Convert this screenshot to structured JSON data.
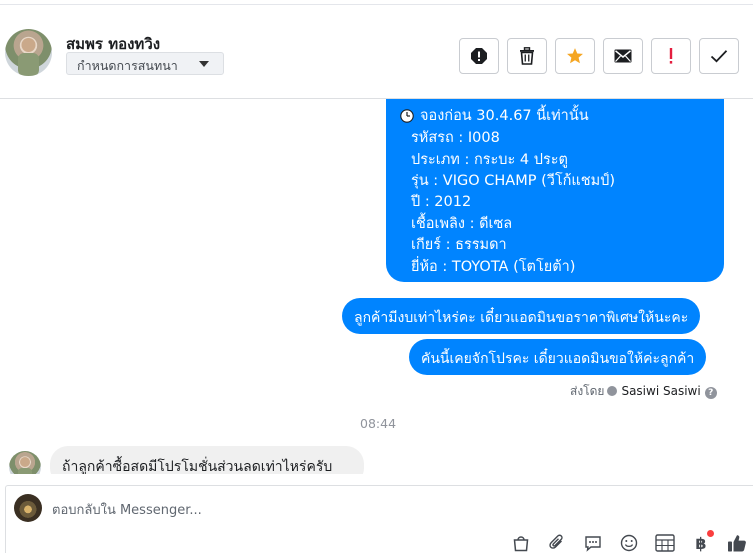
{
  "header": {
    "contact_name": "สมพร ทองทวิง",
    "assign_label": "กำหนดการสนทนา",
    "tools": [
      {
        "name": "spam-icon",
        "color": "#1c1e21"
      },
      {
        "name": "trash-icon",
        "color": "#1c1e21"
      },
      {
        "name": "star-icon",
        "color": "#f5a623"
      },
      {
        "name": "envelope-icon",
        "color": "#1c1e21"
      },
      {
        "name": "exclamation-icon",
        "color": "#e41e3f"
      },
      {
        "name": "checkmark-icon",
        "color": "#1c1e21"
      }
    ]
  },
  "messages": {
    "listing": {
      "deadline": "จองก่อน 30.4.67 นี้เท่านั้น",
      "lines": [
        "รหัสรถ : I008",
        "ประเภท : กระบะ 4 ประตู",
        "รุ่น : VIGO CHAMP (วีโก้แชมป์)",
        "ปี : 2012",
        "เชื้อเพลิง : ดีเซล",
        "เกียร์ : ธรรมดา",
        "ยี่ห้อ : TOYOTA (โตโยต้า)"
      ]
    },
    "sent_1": "ลูกค้ามีงบเท่าไหร่คะ เดี๋ยวแอดมินขอราคาพิเศษให้นะคะ",
    "sent_2": "คันนี้เคยจักโปรคะ เดี๋ยวแอดมินขอให้ค่ะลูกค้า",
    "sent_by_label": "ส่งโดย",
    "sent_by_name": "Sasiwi Sasiwi",
    "help_glyph": "?",
    "timestamp": "08:44",
    "received_1": "ถ้าลูกค้าซื้อสดมีโปรโมชั่นส่วนลดเท่าไหร่ครับ"
  },
  "composer": {
    "placeholder": "ตอบกลับใน Messenger...",
    "tools": [
      "bag-icon",
      "paperclip-icon",
      "chat-bubble-icon",
      "emoji-icon",
      "calculator-icon",
      "baht-icon",
      "thumbs-up-icon"
    ],
    "baht_glyph": "฿"
  },
  "colors": {
    "accent": "#0084ff",
    "received_bubble": "#f0f0f0",
    "notification_dot": "#fa3e3e"
  }
}
